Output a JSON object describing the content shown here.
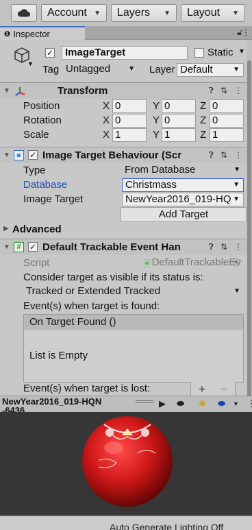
{
  "toolbar": {
    "cloud_icon": "cloud-icon",
    "account": "Account",
    "layers": "Layers",
    "layout": "Layout"
  },
  "tab": {
    "icon": "info-icon",
    "label": "Inspector"
  },
  "object": {
    "name": "ImageTarget",
    "static_label": "Static",
    "tag_label": "Tag",
    "tag_value": "Untagged",
    "layer_label": "Layer",
    "layer_value": "Default"
  },
  "transform": {
    "title": "Transform",
    "rows": [
      {
        "label": "Position",
        "x": "0",
        "y": "0",
        "z": "0"
      },
      {
        "label": "Rotation",
        "x": "0",
        "y": "0",
        "z": "0"
      },
      {
        "label": "Scale",
        "x": "1",
        "y": "1",
        "z": "1"
      }
    ],
    "axis_x": "X",
    "axis_y": "Y",
    "axis_z": "Z"
  },
  "image_target": {
    "title": "Image Target Behaviour (Scr",
    "type_label": "Type",
    "type_value": "From Database",
    "database_label": "Database",
    "database_value": "Christmass",
    "image_target_label": "Image Target",
    "image_target_value": "NewYear2016_019-HQ",
    "add_target": "Add Target",
    "advanced": "Advanced"
  },
  "event_handler": {
    "title": "Default Trackable Event Han",
    "script_label": "Script",
    "script_value": "DefaultTrackableEv",
    "consider_label": "Consider target as visible if its status is:",
    "status_value": "Tracked or Extended Tracked",
    "found_label": "Event(s) when target is found:",
    "on_found": "On Target Found ()",
    "list_empty": "List is Empty",
    "plus": "+",
    "minus": "−",
    "lost_label": "Event(s) when target is lost:"
  },
  "preview": {
    "name_line1": "NewYear2016_019-HQN",
    "name_line2": "-6436"
  },
  "status": {
    "text": "Auto Generate Lighting Off"
  },
  "colors": {
    "accent_blue": "#3a72c4",
    "database_link": "#1a4fc0",
    "ball_red": "#d01818"
  }
}
